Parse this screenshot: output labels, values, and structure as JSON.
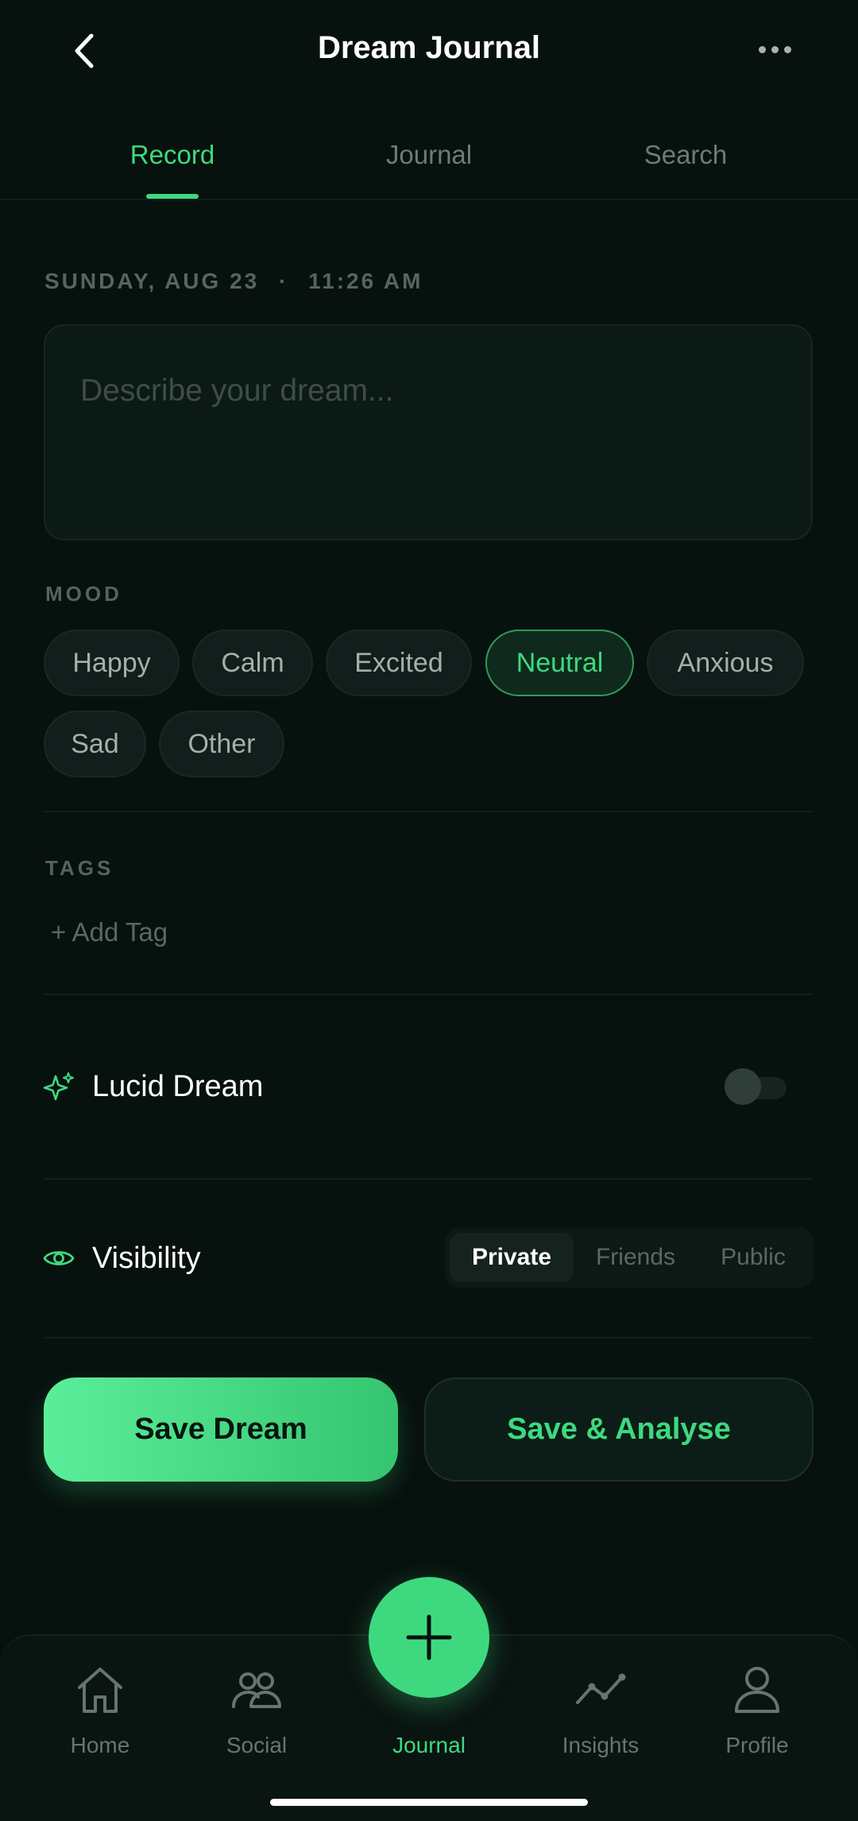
{
  "header": {
    "title": "Dream Journal"
  },
  "tabs": [
    {
      "label": "Record",
      "active": true
    },
    {
      "label": "Journal",
      "active": false
    },
    {
      "label": "Search",
      "active": false
    }
  ],
  "entry": {
    "date": "SUNDAY, AUG 23",
    "separator": "·",
    "time": "11:26 AM",
    "placeholder": "Describe your dream..."
  },
  "mood": {
    "label": "MOOD",
    "options": [
      "Happy",
      "Calm",
      "Excited",
      "Neutral",
      "Anxious",
      "Sad",
      "Other"
    ],
    "selected": "Neutral"
  },
  "tags": {
    "label": "TAGS",
    "add_label": "+ Add Tag"
  },
  "lucid": {
    "label": "Lucid Dream",
    "enabled": false,
    "icon": "sparkles-icon"
  },
  "visibility": {
    "label": "Visibility",
    "icon": "eye-icon",
    "options": [
      "Private",
      "Friends",
      "Public"
    ],
    "selected": "Private"
  },
  "actions": {
    "save_label": "Save Dream",
    "analyse_label": "Save & Analyse"
  },
  "nav": {
    "items": [
      {
        "label": "Home",
        "icon": "home-icon"
      },
      {
        "label": "Social",
        "icon": "people-icon"
      },
      {
        "label": "Journal",
        "icon": "plus-icon",
        "active": true
      },
      {
        "label": "Insights",
        "icon": "chart-line-icon"
      },
      {
        "label": "Profile",
        "icon": "user-icon"
      }
    ]
  },
  "colors": {
    "accent": "#3ed97e",
    "background": "#07110e"
  }
}
